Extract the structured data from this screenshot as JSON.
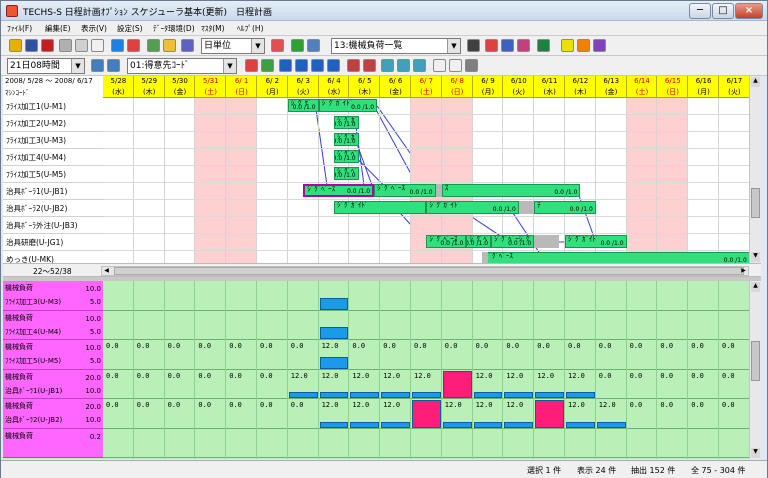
{
  "window": {
    "title": "TECHS-S 日程計画ｵﾌﾟｼｮﾝ スケジューラ基本(更新)　日程計画"
  },
  "menu": [
    "ﾌｧｲﾙ(F)",
    "編集(E)",
    "表示(V)",
    "設定(S)",
    "ﾃﾞｰﾀ環境(D)",
    "ﾏｽﾀ(M)",
    "ﾍﾙﾌﾟ(H)"
  ],
  "toolbar": {
    "unit_select": "日単位",
    "view_select": "13:機械負荷一覧",
    "time_select": "21日08時間",
    "sort_select": "01:得意先ｺｰﾄﾞ"
  },
  "gantt": {
    "period_label": "2008/ 5/28 ～ 2008/ 6/17",
    "machine_header": "ﾏｼﾝｺｰﾄﾞ",
    "range_label": "22～52/38",
    "dates": [
      {
        "d": "5/28",
        "w": "(水)",
        "h": false
      },
      {
        "d": "5/29",
        "w": "(木)",
        "h": false
      },
      {
        "d": "5/30",
        "w": "(金)",
        "h": false
      },
      {
        "d": "5/31",
        "w": "(土)",
        "h": true
      },
      {
        "d": "6/ 1",
        "w": "(日)",
        "h": true
      },
      {
        "d": "6/ 2",
        "w": "(月)",
        "h": false
      },
      {
        "d": "6/ 3",
        "w": "(火)",
        "h": false
      },
      {
        "d": "6/ 4",
        "w": "(水)",
        "h": false
      },
      {
        "d": "6/ 5",
        "w": "(木)",
        "h": false
      },
      {
        "d": "6/ 6",
        "w": "(金)",
        "h": false
      },
      {
        "d": "6/ 7",
        "w": "(土)",
        "h": true
      },
      {
        "d": "6/ 8",
        "w": "(日)",
        "h": true
      },
      {
        "d": "6/ 9",
        "w": "(月)",
        "h": false
      },
      {
        "d": "6/10",
        "w": "(火)",
        "h": false
      },
      {
        "d": "6/11",
        "w": "(水)",
        "h": false
      },
      {
        "d": "6/12",
        "w": "(木)",
        "h": false
      },
      {
        "d": "6/13",
        "w": "(金)",
        "h": false
      },
      {
        "d": "6/14",
        "w": "(土)",
        "h": true
      },
      {
        "d": "6/15",
        "w": "(日)",
        "h": true
      },
      {
        "d": "6/16",
        "w": "(月)",
        "h": false
      },
      {
        "d": "6/17",
        "w": "(火)",
        "h": false
      }
    ],
    "rows": [
      "ﾌﾗｲｽ加工1(U-M1)",
      "ﾌﾗｲｽ加工2(U-M2)",
      "ﾌﾗｲｽ加工3(U-M3)",
      "ﾌﾗｲｽ加工4(U-M4)",
      "ﾌﾗｲｽ加工5(U-M5)",
      "治具ﾎﾞｰﾗ1(U-JB1)",
      "治具ﾎﾞｰﾗ2(U-JB2)",
      "治具ﾎﾞｰﾗ外注(U-JB3)",
      "治具研磨(U-JG1)",
      "めっき(U-MK)"
    ],
    "bars": [
      {
        "row": 0,
        "s": 6.0,
        "e": 7.0,
        "t": "ｼﾞｸﾞｹﾞ",
        "v": "0.0 /1.0"
      },
      {
        "row": 0,
        "s": 7.0,
        "e": 8.9,
        "t": "ｼﾞｸﾞｶﾞｲﾄﾞ",
        "v": "0.0 /1.0"
      },
      {
        "row": 1,
        "s": 7.5,
        "e": 8.3,
        "t": "ｼﾞｸﾞｶﾞｲ",
        "v": "0.0 /1.0"
      },
      {
        "row": 2,
        "s": 7.5,
        "e": 8.3,
        "t": "ｼﾞｸﾞｶﾞｲ",
        "v": "0.0 /1.0"
      },
      {
        "row": 3,
        "s": 7.5,
        "e": 8.3,
        "t": "ｼﾞｸﾞﾍﾞｰ",
        "v": "0.0 /1.0"
      },
      {
        "row": 4,
        "s": 7.5,
        "e": 8.3,
        "t": "ｼﾞｸﾞﾍﾞｰ",
        "v": "0.0 /1.0"
      },
      {
        "row": 5,
        "s": 6.5,
        "e": 8.8,
        "t": "ｼﾞｸﾞﾍﾞｰｽ",
        "v": "0.0 /1.0"
      },
      {
        "row": 5,
        "s": 8.8,
        "e": 10.8,
        "t": "ｼﾞｸﾞﾍﾞｰｽ",
        "v": "0.0 /1.0"
      },
      {
        "row": 5,
        "s": 11.0,
        "e": 15.5,
        "t": "ｽ",
        "v": "0.0 /1.0"
      },
      {
        "row": 6,
        "s": 7.5,
        "e": 10.5,
        "t": "ｼﾞｸﾞｶﾞｲﾄﾞ",
        "v": ""
      },
      {
        "row": 6,
        "s": 10.5,
        "e": 13.5,
        "t": "ｼﾞｸﾞｶﾞｲﾄﾞ",
        "v": "0.0 /1.0"
      },
      {
        "row": 6,
        "s": 14.0,
        "e": 16.0,
        "t": "ﾃ",
        "v": "0.0 /1.0"
      },
      {
        "row": 8,
        "s": 10.5,
        "e": 11.8,
        "t": "ｼﾞｸﾞﾍﾞｰｽ",
        "v": "0.0 /1.0"
      },
      {
        "row": 8,
        "s": 11.8,
        "e": 12.6,
        "t": "ｼﾞｸﾞﾍﾞ",
        "v": "0.0 /1.0"
      },
      {
        "row": 8,
        "s": 12.6,
        "e": 14.0,
        "t": "ｼﾞｸﾞﾍﾞｰｼﾞｸﾞｶﾞｲ",
        "v": "0.0 /1.0"
      },
      {
        "row": 8,
        "s": 15.0,
        "e": 17.0,
        "t": "ｼﾞｸﾞｶﾞｲﾄﾞ",
        "v": "0.0 /1.0"
      },
      {
        "row": 9,
        "s": 12.3,
        "e": 21.0,
        "t": "ｼﾞｸﾞﾍﾞｰｽ",
        "v": "0.0 /1.0"
      }
    ]
  },
  "load": {
    "rows": [
      {
        "type": "機械負荷",
        "name": "ﾌﾗｲｽ加工3(U-M3)",
        "max": "10.0",
        "mid": "5.0",
        "vals": [
          "",
          "",
          "",
          "",
          "",
          "",
          "",
          "",
          "",
          "",
          "",
          "",
          "",
          "",
          "",
          "",
          "",
          "",
          "",
          "",
          ""
        ],
        "bars": [
          0,
          0,
          0,
          0,
          0,
          0,
          0,
          1.0,
          0,
          0,
          0,
          0,
          0,
          0,
          0,
          0,
          0,
          0,
          0,
          0,
          0
        ]
      },
      {
        "type": "機械負荷",
        "name": "ﾌﾗｲｽ加工4(U-M4)",
        "max": "10.0",
        "mid": "5.0",
        "vals": [
          "",
          "",
          "",
          "",
          "",
          "",
          "",
          "",
          "",
          "",
          "",
          "",
          "",
          "",
          "",
          "",
          "",
          "",
          "",
          "",
          ""
        ],
        "bars": [
          0,
          0,
          0,
          0,
          0,
          0,
          0,
          1.0,
          0,
          0,
          0,
          0,
          0,
          0,
          0,
          0,
          0,
          0,
          0,
          0,
          0
        ]
      },
      {
        "type": "機械負荷",
        "name": "ﾌﾗｲｽ加工5(U-M5)",
        "max": "10.0",
        "mid": "5.0",
        "vals": [
          "0.0",
          "0.0",
          "0.0",
          "0.0",
          "0.0",
          "0.0",
          "0.0",
          "12.0",
          "0.0",
          "0.0",
          "0.0",
          "0.0",
          "0.0",
          "0.0",
          "0.0",
          "0.0",
          "0.0",
          "0.0",
          "0.0",
          "0.0",
          "0.0"
        ],
        "bars": [
          0,
          0,
          0,
          0,
          0,
          0,
          0,
          1.0,
          0,
          0,
          0,
          0,
          0,
          0,
          0,
          0,
          0,
          0,
          0,
          0,
          0
        ]
      },
      {
        "type": "機械負荷",
        "name": "治具ﾎﾞｰﾗ1(U-JB1)",
        "max": "20.0",
        "mid": "10.0",
        "vals": [
          "0.0",
          "0.0",
          "0.0",
          "0.0",
          "0.0",
          "0.0",
          "12.0",
          "12.0",
          "12.0",
          "12.0",
          "12.0",
          "24.0",
          "12.0",
          "12.0",
          "12.0",
          "12.0",
          "0.0",
          "0.0",
          "0.0",
          "0.0",
          "0.0"
        ],
        "bars": [
          0,
          0,
          0,
          0,
          0,
          0,
          0.5,
          0.5,
          0.5,
          0.5,
          0.5,
          1.2,
          0.5,
          0.5,
          0.5,
          0.5,
          0,
          0,
          0,
          0,
          0
        ]
      },
      {
        "type": "機械負荷",
        "name": "治具ﾎﾞｰﾗ2(U-JB2)",
        "max": "20.0",
        "mid": "10.0",
        "vals": [
          "0.0",
          "0.0",
          "0.0",
          "0.0",
          "0.0",
          "0.0",
          "0.0",
          "12.0",
          "12.0",
          "12.0",
          "24.0",
          "12.0",
          "12.0",
          "12.0",
          "24.0",
          "12.0",
          "12.0",
          "0.0",
          "0.0",
          "0.0",
          "0.0"
        ],
        "bars": [
          0,
          0,
          0,
          0,
          0,
          0,
          0,
          0.5,
          0.5,
          0.5,
          1.2,
          0.5,
          0.5,
          0.5,
          1.2,
          0.5,
          0.5,
          0,
          0,
          0,
          0
        ]
      },
      {
        "type": "機械負荷",
        "name": "",
        "max": "0.2",
        "mid": "",
        "vals": [
          "",
          "",
          "",
          "",
          "",
          "",
          "",
          "",
          "",
          "",
          "",
          "",
          "",
          "",
          "",
          "",
          "",
          "",
          "",
          "",
          ""
        ],
        "bars": [
          0,
          0,
          0,
          0,
          0,
          0,
          0,
          0,
          0,
          0,
          0,
          0,
          0,
          0,
          0,
          0,
          0,
          0,
          0,
          0,
          0
        ]
      }
    ]
  },
  "status": {
    "sel": "選択 1 件",
    "show": "表示 24 件",
    "extract": "抽出 152 件",
    "all": "全 75 - 304 件"
  },
  "colors": {
    "bar": "#2fe07c",
    "grey": "#b9b9b9",
    "loadbar": "#1a9ae8",
    "overload": "#ff1d7a",
    "holiday": "#ffd0d0",
    "loadbg": "#b8f0b8",
    "header": "#ffff00"
  }
}
